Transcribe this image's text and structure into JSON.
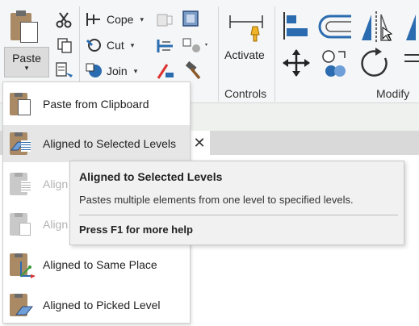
{
  "ribbon": {
    "clipboard": {
      "paste_label": "Paste",
      "paste_caret": "▾"
    },
    "geometry": {
      "cope_label": "Cope",
      "cut_label": "Cut",
      "join_label": "Join",
      "caret": "▾"
    },
    "controls": {
      "activate_label": "Activate",
      "panel_title": "Controls"
    },
    "modify": {
      "panel_title": "Modify"
    }
  },
  "view_tab": {
    "close_glyph": "✕"
  },
  "paste_menu": {
    "items": [
      {
        "label": "Paste from Clipboard",
        "enabled": true,
        "highlighted": false,
        "icon": "paste-clipboard-icon"
      },
      {
        "label": "Aligned to Selected Levels",
        "enabled": true,
        "highlighted": true,
        "icon": "aligned-selected-levels-icon"
      },
      {
        "label": "Aligned to Selected Views",
        "visible_text": "Align",
        "enabled": false,
        "highlighted": false,
        "icon": "aligned-selected-views-icon"
      },
      {
        "label": "Aligned to Current View",
        "visible_text": "Align",
        "enabled": false,
        "highlighted": false,
        "icon": "aligned-current-view-icon"
      },
      {
        "label": "Aligned to Same Place",
        "enabled": true,
        "highlighted": false,
        "icon": "aligned-same-place-icon"
      },
      {
        "label": "Aligned to Picked Level",
        "enabled": true,
        "highlighted": false,
        "icon": "aligned-picked-level-icon"
      }
    ]
  },
  "tooltip": {
    "title": "Aligned to Selected Levels",
    "description": "Pastes multiple elements from one level to specified levels.",
    "help": "Press F1 for more help"
  },
  "colors": {
    "ribbon_bg": "#f5f6f7",
    "highlight": "#e6e6e6",
    "accent_blue": "#2b6cb0",
    "clipboard_brown": "#a98a64"
  }
}
